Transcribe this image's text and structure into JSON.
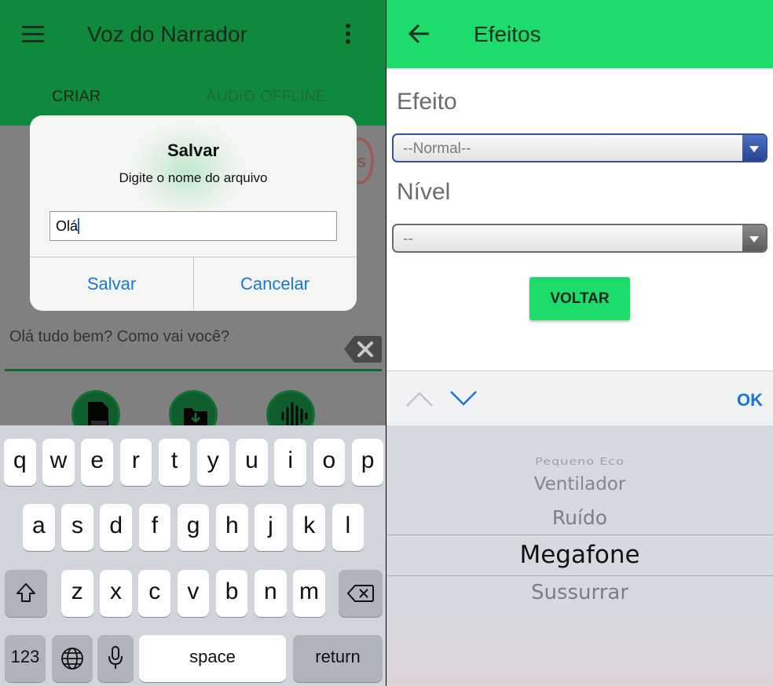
{
  "left": {
    "app_title": "Voz do Narrador",
    "tabs": [
      "CRIAR",
      "AUDIO OFFLINE"
    ],
    "ghost_badge_text": "s",
    "text_field_value": "Olá tudo bem? Como vai você?",
    "fab_icons": [
      "txt-file-icon",
      "folder-download-icon",
      "audio-wave-icon"
    ],
    "dialog": {
      "title": "Salvar",
      "message": "Digite o nome do arquivo",
      "input_value": "Olá",
      "save_label": "Salvar",
      "cancel_label": "Cancelar"
    },
    "keyboard": {
      "row1": [
        "q",
        "w",
        "e",
        "r",
        "t",
        "y",
        "u",
        "i",
        "o",
        "p"
      ],
      "row2": [
        "a",
        "s",
        "d",
        "f",
        "g",
        "h",
        "j",
        "k",
        "l"
      ],
      "row3": [
        "z",
        "x",
        "c",
        "v",
        "b",
        "n",
        "m"
      ],
      "numbers_label": "123",
      "space_label": "space",
      "return_label": "return"
    }
  },
  "right": {
    "title": "Efeitos",
    "effect_label": "Efeito",
    "effect_value": "--Normal--",
    "level_label": "Nível",
    "level_value": "--",
    "back_button_label": "VOLTAR",
    "toolbar_ok": "OK",
    "picker": {
      "items": [
        "Pequeno Eco",
        "Ventilador",
        "Ruído",
        "Megafone",
        "Sussurrar"
      ],
      "selected": "Megafone"
    }
  },
  "colors": {
    "left_appbar": "#0f8a3c",
    "right_appbar": "#1edc6c",
    "ios_blue": "#1a76d8"
  }
}
